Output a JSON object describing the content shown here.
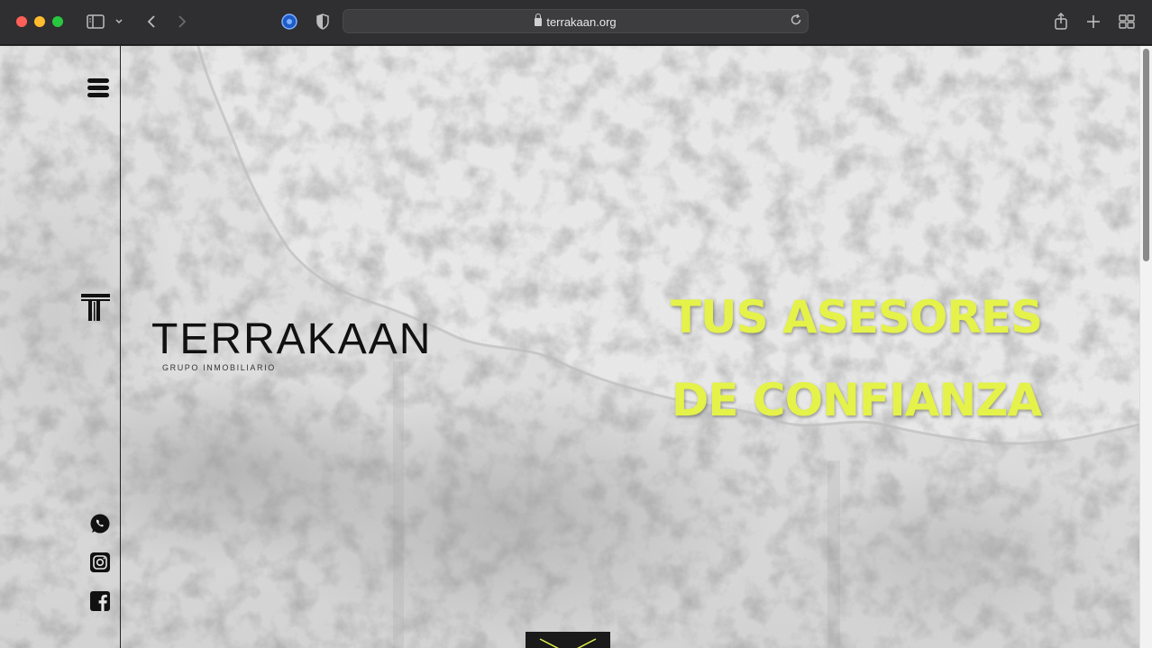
{
  "browser": {
    "url": "terrakaan.org",
    "icons": [
      "sidebar-icon",
      "chevron-down-icon",
      "back-icon",
      "forward-icon",
      "extension-icon",
      "shield-icon",
      "reload-icon",
      "share-icon",
      "new-tab-icon",
      "tab-overview-icon"
    ]
  },
  "brand": {
    "name": "TERRAKAAN",
    "subtitle": "GRUPO INMOBILIARIO"
  },
  "hero": {
    "line1": "TUS ASESORES",
    "line2": "DE CONFIANZA",
    "accent_color": "#e4f24a"
  },
  "sidebar": {
    "icons": [
      "menu-icon",
      "terrakaan-logo-icon",
      "whatsapp-icon",
      "instagram-icon",
      "facebook-icon"
    ]
  }
}
